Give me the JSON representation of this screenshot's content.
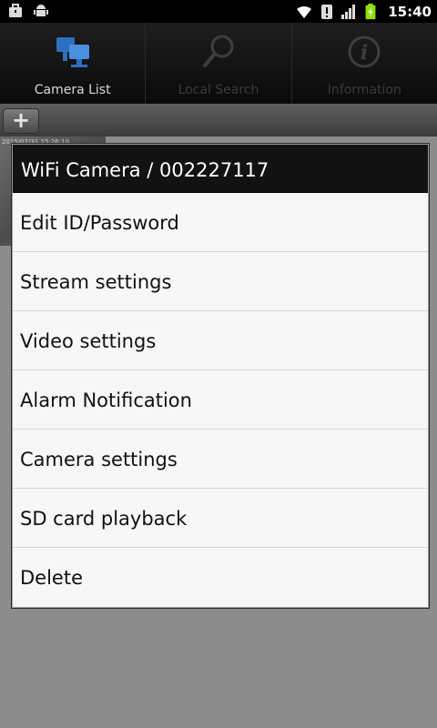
{
  "status_bar": {
    "time": "15:40",
    "icons": [
      "briefcase-icon",
      "android-icon",
      "wifi-icon",
      "alert-icon",
      "signal-icon",
      "battery-icon"
    ]
  },
  "tabs": [
    {
      "label": "Camera List",
      "icon": "camera-list-icon",
      "active": true
    },
    {
      "label": "Local Search",
      "icon": "search-icon",
      "active": false
    },
    {
      "label": "Information",
      "icon": "info-icon",
      "active": false
    }
  ],
  "toolbar": {
    "add_label": "+"
  },
  "background": {
    "thumb_stamp": "2015/07/31 15:26:10"
  },
  "dialog": {
    "title": "WiFi Camera / 002227117",
    "items": [
      {
        "label": "Edit ID/Password"
      },
      {
        "label": "Stream settings"
      },
      {
        "label": "Video settings"
      },
      {
        "label": "Alarm Notification"
      },
      {
        "label": "Camera settings"
      },
      {
        "label": "SD card playback"
      },
      {
        "label": "Delete"
      }
    ]
  },
  "colors": {
    "tab_active_icon": "#2e6fbf",
    "tab_inactive": "#3b3b3b",
    "dialog_title_bg": "#121212",
    "dialog_body_bg": "#f7f7f7"
  }
}
